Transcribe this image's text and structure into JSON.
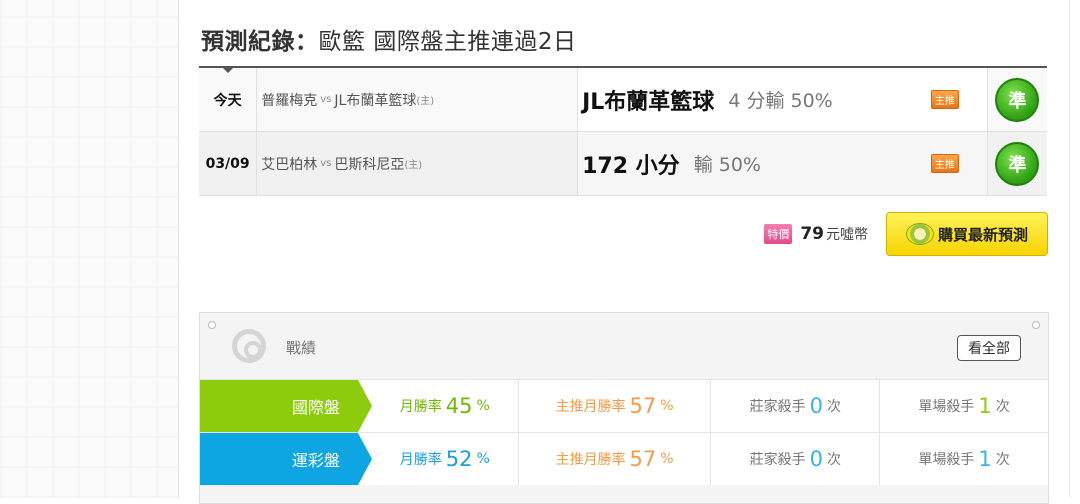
{
  "header": {
    "label": "預測紀錄：",
    "sport": "歐籃",
    "streak": "國際盤主推連過2日"
  },
  "records": [
    {
      "date": "今天",
      "team_a": "普羅梅克",
      "vs": "vs",
      "team_b": "JL布蘭革籃球",
      "home_mark": "(主)",
      "pick": "JL布蘭革籃球",
      "detail": "4 分輸 50%",
      "badge": "主推",
      "result": "準"
    },
    {
      "date": "03/09",
      "team_a": "艾巴柏林",
      "vs": "vs",
      "team_b": "巴斯科尼亞",
      "home_mark": "(主)",
      "pick": "172 小分",
      "detail": "輸 50%",
      "badge": "主推",
      "result": "準"
    }
  ],
  "purchase": {
    "special_tag": "特價",
    "price": "79",
    "unit": "元噓幣",
    "button_label": "購買最新預測"
  },
  "stats": {
    "title": "戰績",
    "view_all": "看全部",
    "rows": [
      {
        "category": "國際盤",
        "month_rate_label": "月勝率",
        "month_rate": "45",
        "main_rate_label": "主推月勝率",
        "main_rate": "57",
        "pct": "%",
        "banker_label": "莊家殺手",
        "banker_count": "0",
        "single_label": "單場殺手",
        "single_count": "1",
        "times": "次"
      },
      {
        "category": "運彩盤",
        "month_rate_label": "月勝率",
        "month_rate": "52",
        "main_rate_label": "主推月勝率",
        "main_rate": "57",
        "pct": "%",
        "banker_label": "莊家殺手",
        "banker_count": "0",
        "single_label": "單場殺手",
        "single_count": "1",
        "times": "次"
      }
    ]
  },
  "colors": {
    "intl_green": "#8ccc0d",
    "lottery_blue": "#0ea5e3",
    "orange": "#f49a4a",
    "win_green": "#2e9e12"
  }
}
